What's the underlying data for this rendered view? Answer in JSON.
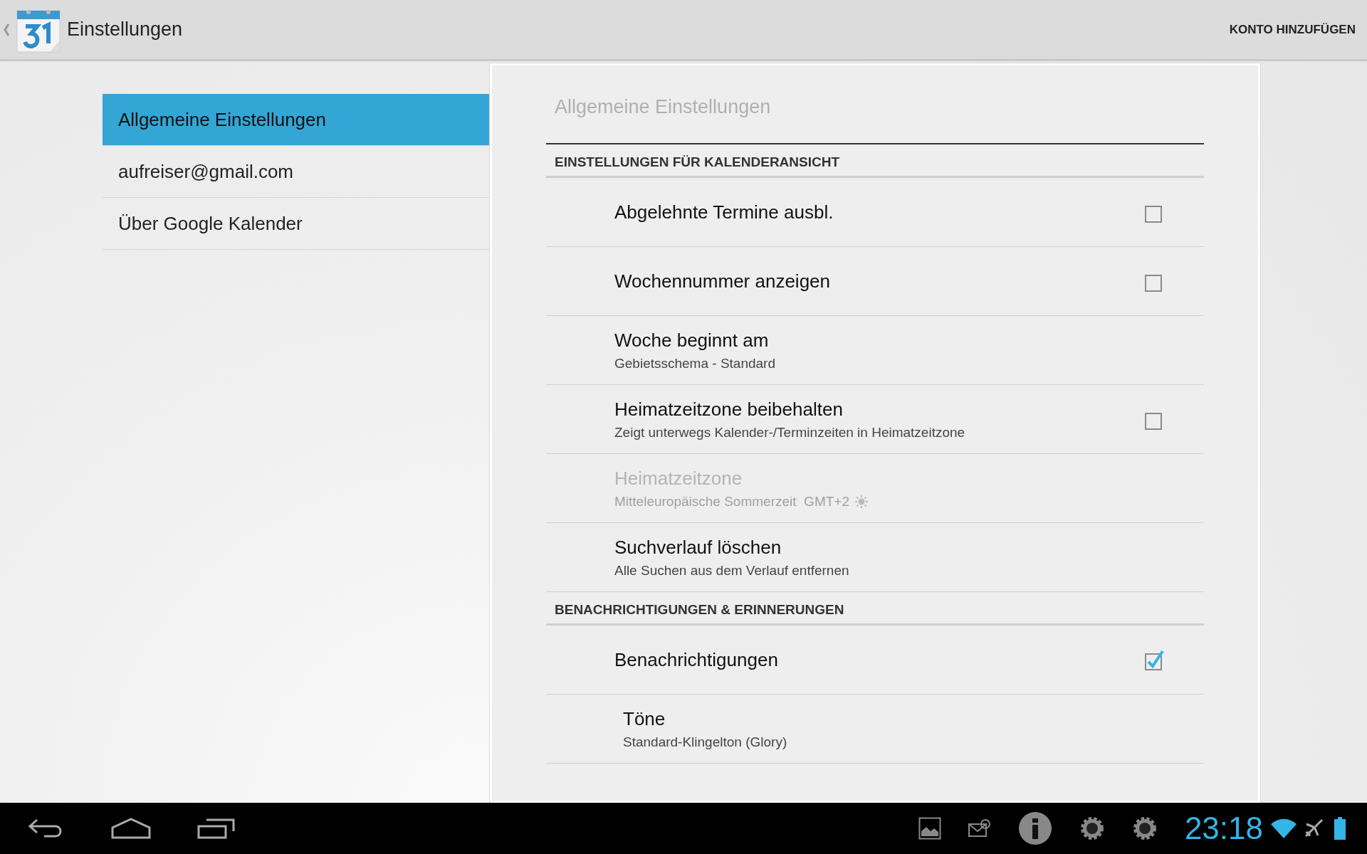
{
  "action_bar": {
    "title": "Einstellungen",
    "action": "KONTO HINZUFÜGEN"
  },
  "nav": [
    {
      "label": "Allgemeine Einstellungen",
      "selected": true
    },
    {
      "label": "aufreiser@gmail.com",
      "selected": false
    },
    {
      "label": "Über Google Kalender",
      "selected": false
    }
  ],
  "panel": {
    "title": "Allgemeine Einstellungen",
    "sections": [
      {
        "header": "EINSTELLUNGEN FÜR KALENDERANSICHT",
        "items": [
          {
            "kind": "checkbox",
            "title": "Abgelehnte Termine ausbl.",
            "checked": false,
            "disabled": false
          },
          {
            "kind": "checkbox",
            "title": "Wochennummer anzeigen",
            "checked": false,
            "disabled": false
          },
          {
            "kind": "plain",
            "title": "Woche beginnt am",
            "summary": "Gebietsschema - Standard",
            "disabled": false
          },
          {
            "kind": "checkbox",
            "title": "Heimatzeitzone beibehalten",
            "summary": "Zeigt unterwegs Kalender-/Terminzeiten in Heimatzeitzone",
            "checked": false,
            "disabled": false
          },
          {
            "kind": "plain",
            "title": "Heimatzeitzone",
            "summary": "Mitteleuropäische Sommerzeit  GMT+2",
            "daylight_saving": true,
            "disabled": true
          },
          {
            "kind": "plain",
            "title": "Suchverlauf löschen",
            "summary": "Alle Suchen aus dem Verlauf entfernen",
            "disabled": false
          }
        ]
      },
      {
        "header": "BENACHRICHTIGUNGEN & ERINNERUNGEN",
        "items": [
          {
            "kind": "checkbox",
            "title": "Benachrichtigungen",
            "checked": true,
            "disabled": false
          },
          {
            "kind": "plain",
            "title": "Töne",
            "summary": "Standard-Klingelton (Glory)",
            "disabled": false
          }
        ]
      }
    ]
  },
  "system_bar": {
    "time": "23:18"
  }
}
